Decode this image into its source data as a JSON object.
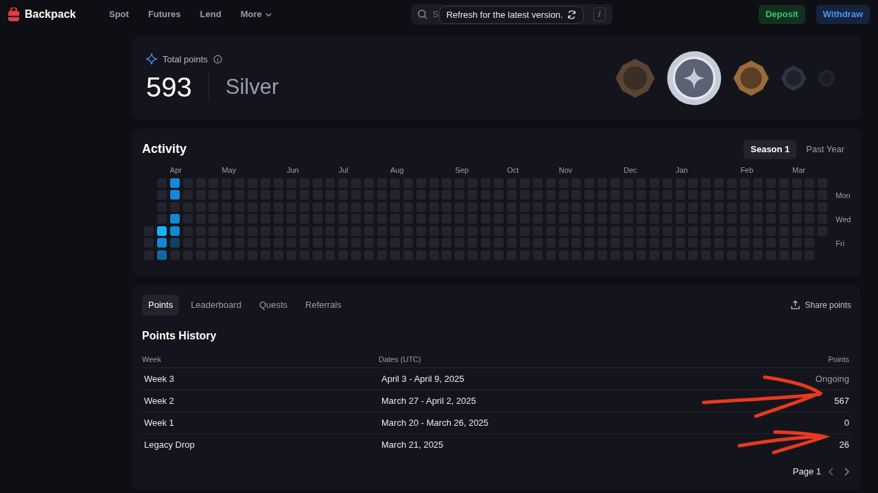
{
  "brand": "Backpack",
  "nav": [
    {
      "label": "Spot",
      "kind": "link"
    },
    {
      "label": "Futures",
      "kind": "link"
    },
    {
      "label": "Lend",
      "kind": "link"
    },
    {
      "label": "More",
      "kind": "dropdown"
    }
  ],
  "search": {
    "placeholder": "S",
    "shortcut": "/"
  },
  "toast": {
    "text": "Refresh for the latest version."
  },
  "actions": [
    {
      "label": "Deposit",
      "kind": "deposit"
    },
    {
      "label": "Withdraw",
      "kind": "withdraw"
    }
  ],
  "points": {
    "label": "Total points",
    "value": "593",
    "tier": "Silver",
    "badges": [
      {
        "kind": "bronze",
        "selected": false
      },
      {
        "kind": "silver",
        "selected": true
      },
      {
        "kind": "gold",
        "selected": false
      },
      {
        "kind": "platinum",
        "selected": false
      },
      {
        "kind": "diamond",
        "selected": false
      }
    ]
  },
  "activity": {
    "title": "Activity",
    "ranges": [
      {
        "label": "Season 1",
        "selected": true
      },
      {
        "label": "Past Year",
        "selected": false
      }
    ],
    "months": [
      "Apr",
      "May",
      "Jun",
      "Jul",
      "Aug",
      "Sep",
      "Oct",
      "Nov",
      "Dec",
      "Jan",
      "Feb",
      "Mar"
    ],
    "days": [
      "Mon",
      "Wed",
      "Fri"
    ],
    "first_weeks": [
      {
        "days": [
          {
            "color": "#23242e"
          },
          {
            "color": "#23242e"
          },
          {
            "color": "#23242e"
          }
        ]
      },
      {
        "days": [
          {
            "color": "#23242e"
          },
          {
            "color": "#23242e"
          },
          {
            "color": "#23242e"
          },
          {
            "color": "#23242e"
          },
          {
            "color": "#16b4f4"
          },
          {
            "color": "#1289d4"
          },
          {
            "color": "#0f6aa0"
          }
        ]
      },
      {
        "days": [
          {
            "color": "#1289d4"
          },
          {
            "color": "#1289d4"
          },
          {
            "color": "#23242e"
          },
          {
            "color": "#1289d4"
          },
          {
            "color": "#1289d4"
          },
          {
            "color": "#16405f"
          },
          {
            "color": "#23242e"
          }
        ]
      }
    ]
  },
  "tabs": [
    {
      "label": "Points",
      "selected": true
    },
    {
      "label": "Leaderboard",
      "selected": false
    },
    {
      "label": "Quests",
      "selected": false
    },
    {
      "label": "Referrals",
      "selected": false
    }
  ],
  "share": "Share points",
  "history": {
    "title": "Points History",
    "columns": [
      "Week",
      "Dates (UTC)",
      "Points"
    ],
    "rows": [
      {
        "week": "Week 3",
        "dates": "April 3 - April 9, 2025",
        "points": "Ongoing",
        "kind": "ongoing"
      },
      {
        "week": "Week 2",
        "dates": "March 27 - April 2, 2025",
        "points": "567",
        "kind": "value"
      },
      {
        "week": "Week 1",
        "dates": "March 20 - March 26, 2025",
        "points": "0",
        "kind": "value"
      },
      {
        "week": "Legacy Drop",
        "dates": "March 21, 2025",
        "points": "26",
        "kind": "value"
      }
    ]
  },
  "pager": {
    "label": "Page 1"
  }
}
